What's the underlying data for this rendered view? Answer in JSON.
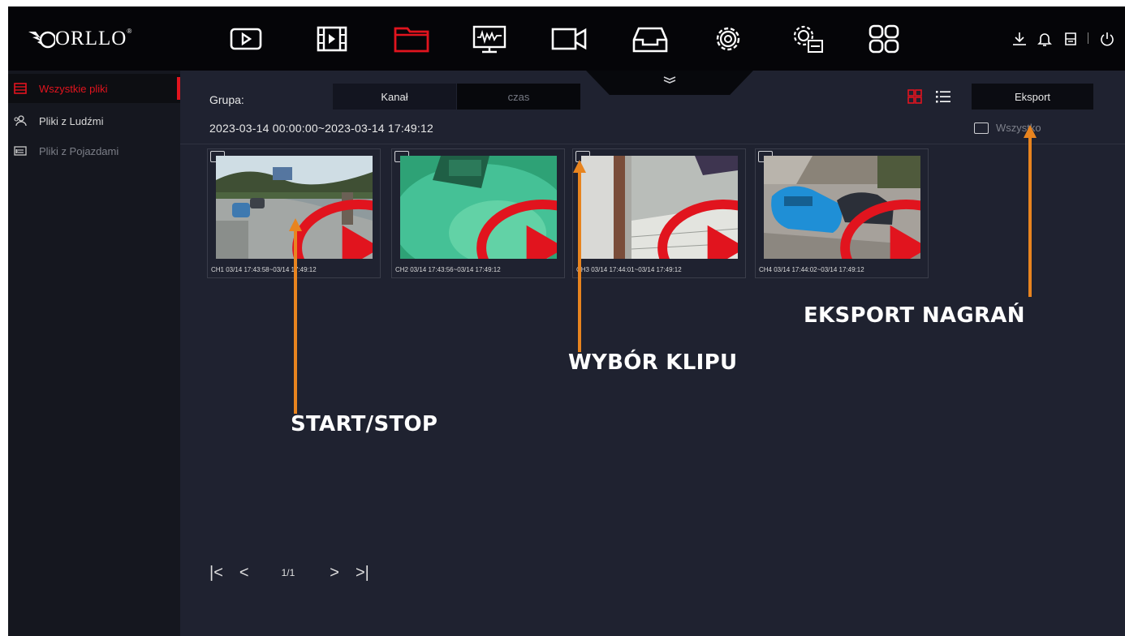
{
  "logo": {
    "text": "ORLLO",
    "tm": "®"
  },
  "nav": [
    "playback-icon",
    "clip-icon",
    "files-icon",
    "monitor-icon",
    "camera-icon",
    "inbox-icon",
    "settings-icon",
    "system-icon",
    "apps-icon"
  ],
  "accent_color": "#e1141e",
  "annotation_color": "#e8841f",
  "sidebar": {
    "items": [
      {
        "label": "Wszystkie pliki",
        "active": true
      },
      {
        "label": "Pliki z Ludźmi",
        "active": false
      },
      {
        "label": "Pliki z Pojazdami",
        "active": false
      }
    ]
  },
  "filter": {
    "group_label": "Grupa:",
    "segments": [
      "Kanał",
      "czas"
    ],
    "date_range": "2023-03-14 00:00:00~2023-03-14 17:49:12",
    "export_label": "Eksport",
    "select_all_label": "Wszystko"
  },
  "clips": [
    {
      "caption": "CH1 03/14 17:43:58~03/14 17:49:12"
    },
    {
      "caption": "CH2 03/14 17:43:56~03/14 17:49:12"
    },
    {
      "caption": "CH3 03/14 17:44:01~03/14 17:49:12"
    },
    {
      "caption": "CH4 03/14 17:44:02~03/14 17:49:12"
    }
  ],
  "pager": {
    "first": "|<",
    "prev": "<",
    "page": "1/1",
    "next": ">",
    "last": ">|"
  },
  "annotations": {
    "start_stop": "START/STOP",
    "clip_select": "WYBÓR KLIPU",
    "export": "EKSPORT NAGRAŃ"
  }
}
